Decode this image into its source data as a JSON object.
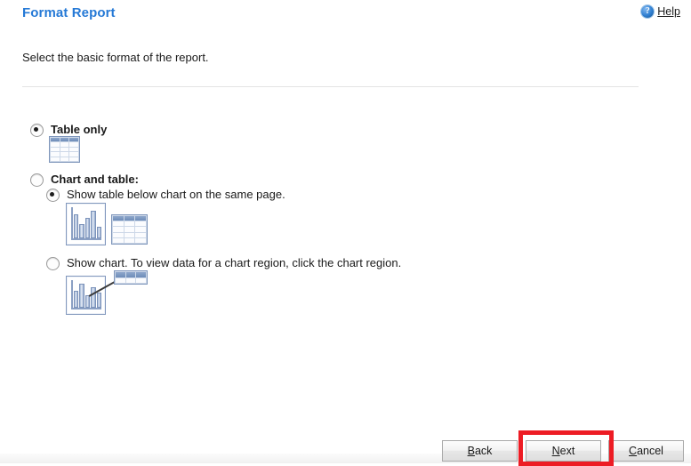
{
  "header": {
    "title": "Format Report",
    "help_label": "Help",
    "help_icon": "help-circle-icon",
    "title_color": "#2579d6"
  },
  "intro": {
    "text": "Select the basic format of the report."
  },
  "options": [
    {
      "id": "table-only",
      "label": "Table only",
      "selected": true,
      "icon": "table-icon"
    },
    {
      "id": "chart-and-table",
      "label": "Chart and table:",
      "selected": false,
      "suboptions": [
        {
          "id": "show-table-below-chart",
          "label": "Show table below chart on the same page.",
          "selected": true,
          "icon": "chart-and-table-icon"
        },
        {
          "id": "show-chart-click-region",
          "label": "Show chart. To view data for a chart region, click the chart region.",
          "selected": false,
          "icon": "chart-with-callout-icon"
        }
      ]
    }
  ],
  "buttons": {
    "back": {
      "label": "Back",
      "accesskey": "B"
    },
    "next": {
      "label": "Next",
      "accesskey": "N"
    },
    "cancel": {
      "label": "Cancel",
      "accesskey": "C"
    }
  },
  "annotation": {
    "highlight_target": "next-button",
    "highlight_color": "#ed1c24"
  }
}
